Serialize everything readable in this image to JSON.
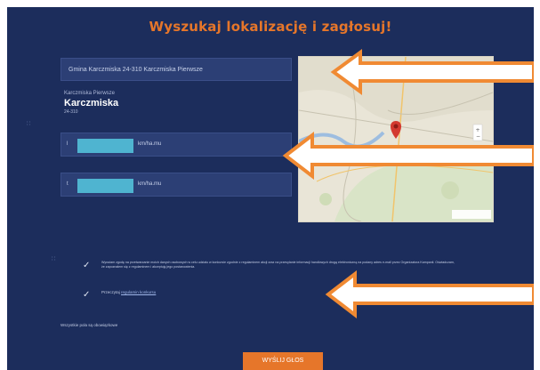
{
  "header": {
    "title": "Wyszukaj lokalizację i zagłosuj!"
  },
  "search": {
    "value": "Gmina Karczmiska 24-310 Karczmiska Pierwsze"
  },
  "locality": {
    "region": "Karczmiska Pierwsze",
    "name": "Karczmiska",
    "code": "24-310"
  },
  "rows": [
    {
      "prefix": "l",
      "suffix": "km/ha.mu"
    },
    {
      "prefix": "t",
      "suffix": "km/ha.mu"
    }
  ],
  "consents": {
    "text_1": "Wyrażam zgodę na przetwarzanie moich danych osobowych w celu udziału w konkursie zgodnie z regulaminem akcji oraz na przesyłanie informacji handlowych drogą elektroniczną na podany adres e-mail przez Organizatora Kampanii. Oświadczam, że zapoznałem się z regulaminem i akceptuję jego postanowienia.",
    "text_2_prefix": "Przeczytaj",
    "text_2_link": "regulamin konkursu"
  },
  "required_note": "Wszystkie pola są obowiązkowe",
  "submit": {
    "label": "WYŚLIJ GŁOS"
  },
  "colors": {
    "background": "#1c2d5c",
    "accent": "#e6762a",
    "arrow": "#f08a33",
    "redaction": "#4fb4d0"
  }
}
